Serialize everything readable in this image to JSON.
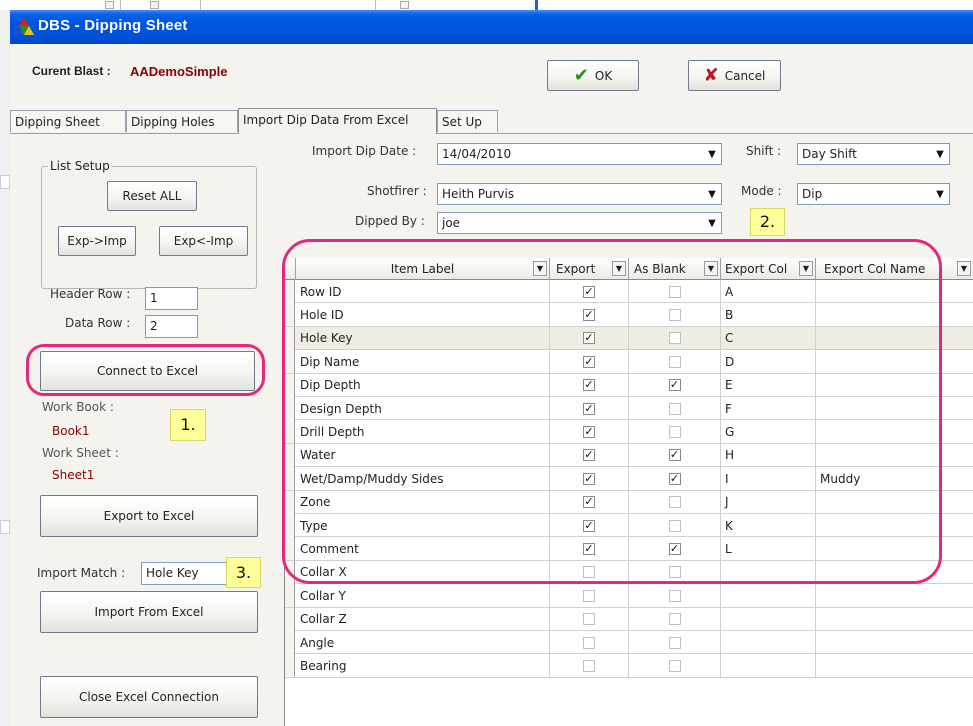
{
  "dialog": {
    "title": "DBS - Dipping Sheet",
    "blast_label": "Curent Blast :",
    "blast_value": "AADemoSimple",
    "ok_label": "OK",
    "cancel_label": "Cancel"
  },
  "tabs": [
    {
      "label": "Dipping Sheet"
    },
    {
      "label": "Dipping Holes"
    },
    {
      "label": "Import Dip Data From Excel"
    },
    {
      "label": "Set Up"
    }
  ],
  "left": {
    "list_setup": "List Setup",
    "reset_all": "Reset ALL",
    "exp_imp": "Exp->Imp",
    "exp_from_imp": "Exp<-Imp",
    "header_row_label": "Header Row :",
    "header_row_value": "1",
    "data_row_label": "Data Row :",
    "data_row_value": "2",
    "connect": "Connect to Excel",
    "workbook_label": "Work Book :",
    "workbook_value": "Book1",
    "worksheet_label": "Work Sheet :",
    "worksheet_value": "Sheet1",
    "export": "Export to Excel",
    "import_match_label": "Import Match :",
    "import_match_value": "Hole Key",
    "import": "Import From Excel",
    "close": "Close Excel Connection"
  },
  "form": {
    "import_date_label": "Import Dip Date :",
    "import_date_value": "14/04/2010",
    "shift_label": "Shift :",
    "shift_value": "Day Shift",
    "shotfirer_label": "Shotfirer :",
    "shotfirer_value": "Heith Purvis",
    "mode_label": "Mode :",
    "mode_value": "Dip",
    "dipped_by_label": "Dipped By :",
    "dipped_by_value": "joe"
  },
  "annotations": {
    "note1": "1.",
    "note2": "2.",
    "note3": "3."
  },
  "grid": {
    "headers": [
      "Item Label",
      "Export",
      "As Blank",
      "Export Col",
      "Export Col Name"
    ],
    "rows": [
      {
        "label": "Row ID",
        "export": true,
        "blank": false,
        "col": "A",
        "name": ""
      },
      {
        "label": "Hole ID",
        "export": true,
        "blank": false,
        "col": "B",
        "name": ""
      },
      {
        "label": "Hole Key",
        "export": true,
        "blank": false,
        "col": "C",
        "name": ""
      },
      {
        "label": "Dip Name",
        "export": true,
        "blank": false,
        "col": "D",
        "name": ""
      },
      {
        "label": "Dip Depth",
        "export": true,
        "blank": true,
        "col": "E",
        "name": ""
      },
      {
        "label": "Design Depth",
        "export": true,
        "blank": false,
        "col": "F",
        "name": ""
      },
      {
        "label": "Drill Depth",
        "export": true,
        "blank": false,
        "col": "G",
        "name": ""
      },
      {
        "label": "Water",
        "export": true,
        "blank": true,
        "col": "H",
        "name": ""
      },
      {
        "label": "Wet/Damp/Muddy Sides",
        "export": true,
        "blank": true,
        "col": "I",
        "name": "Muddy"
      },
      {
        "label": "Zone",
        "export": true,
        "blank": false,
        "col": "J",
        "name": ""
      },
      {
        "label": "Type",
        "export": true,
        "blank": false,
        "col": "K",
        "name": ""
      },
      {
        "label": "Comment",
        "export": true,
        "blank": true,
        "col": "L",
        "name": ""
      },
      {
        "label": "Collar X",
        "export": false,
        "blank": false,
        "col": "",
        "name": ""
      },
      {
        "label": "Collar Y",
        "export": false,
        "blank": false,
        "col": "",
        "name": ""
      },
      {
        "label": "Collar Z",
        "export": false,
        "blank": false,
        "col": "",
        "name": ""
      },
      {
        "label": "Angle",
        "export": false,
        "blank": false,
        "col": "",
        "name": ""
      },
      {
        "label": "Bearing",
        "export": false,
        "blank": false,
        "col": "",
        "name": ""
      }
    ]
  },
  "colors": {
    "titlebar": "#0054e3",
    "accent_pink": "#e6287d",
    "darkred": "#8b0000",
    "sticky": "#ffff99"
  }
}
